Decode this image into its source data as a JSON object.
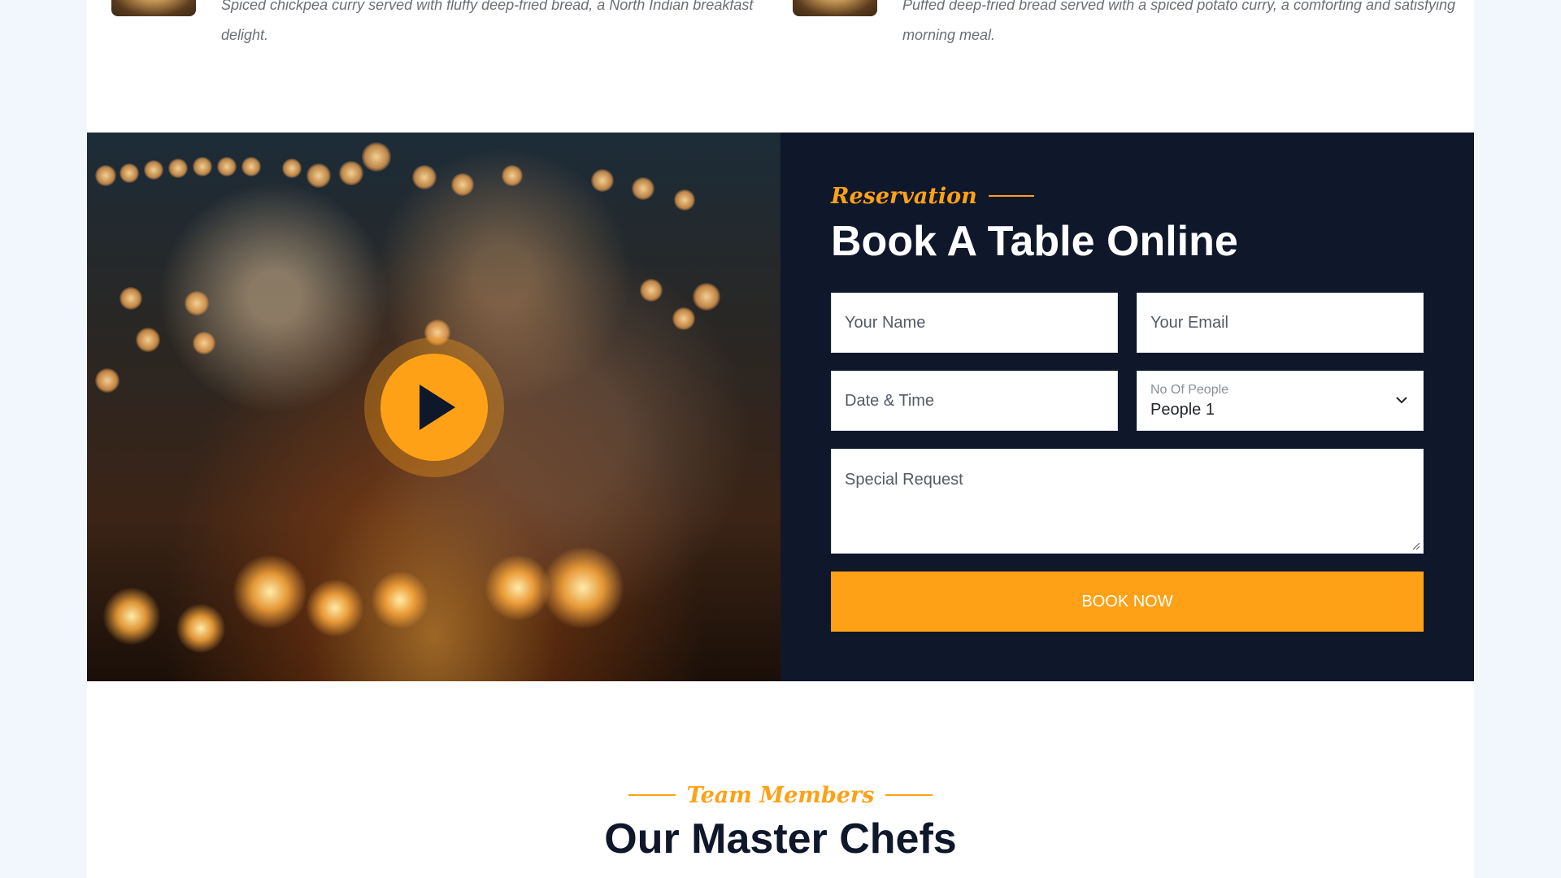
{
  "menu": {
    "items": [
      {
        "description": "Spiced chickpea curry served with fluffy deep-fried bread, a North Indian breakfast delight."
      },
      {
        "description": "Puffed deep-fried bread served with a spiced potato curry, a comforting and satisfying morning meal."
      }
    ]
  },
  "reservation": {
    "eyebrow": "Reservation",
    "title": "Book A Table Online",
    "video_button_icon": "play-icon",
    "form": {
      "name_placeholder": "Your Name",
      "email_placeholder": "Your Email",
      "datetime_placeholder": "Date & Time",
      "people_label": "No Of People",
      "people_value": "People 1",
      "request_placeholder": "Special Request",
      "submit_label": "BOOK NOW"
    }
  },
  "team": {
    "eyebrow": "Team Members",
    "title": "Our Master Chefs"
  },
  "colors": {
    "accent": "#fea116",
    "dark": "#0f172b",
    "page_bg": "#f2f7fd"
  }
}
